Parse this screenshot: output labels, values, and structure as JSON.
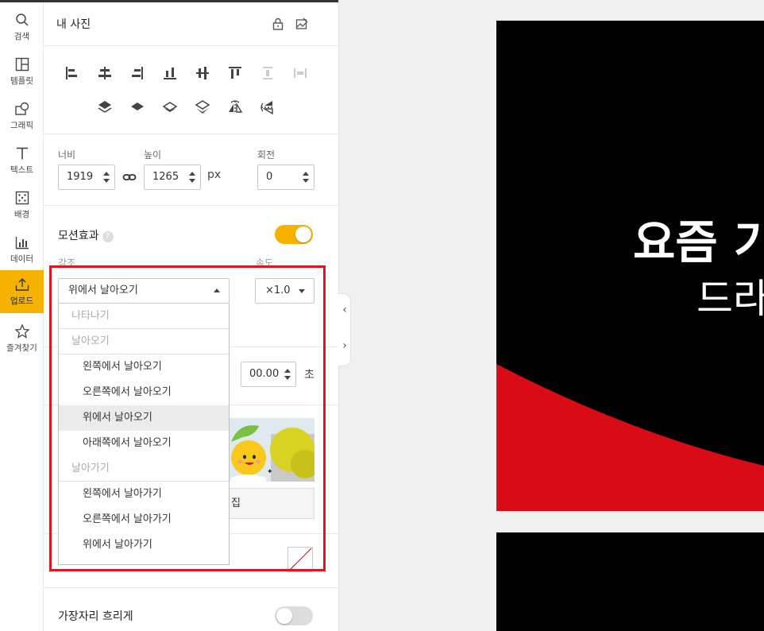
{
  "rail": {
    "items": [
      {
        "label": "검색",
        "icon": "search-icon"
      },
      {
        "label": "템플릿",
        "icon": "template-icon"
      },
      {
        "label": "그래픽",
        "icon": "graphic-icon"
      },
      {
        "label": "텍스트",
        "icon": "text-icon"
      },
      {
        "label": "배경",
        "icon": "background-icon"
      },
      {
        "label": "데이터",
        "icon": "chart-icon"
      },
      {
        "label": "업로드",
        "icon": "upload-icon",
        "active": true
      },
      {
        "label": "즐겨찾기",
        "icon": "star-icon"
      }
    ]
  },
  "panel": {
    "title": "내 사진",
    "size": {
      "width_label": "너비",
      "width_value": "1919",
      "height_label": "높이",
      "height_value": "1265",
      "unit": "px",
      "rotation_label": "회전",
      "rotation_value": "0"
    },
    "motion": {
      "title": "모션효과",
      "help": "?",
      "enabled": true,
      "emphasis_label": "강조",
      "speed_label": "속도",
      "selected_effect": "위에서 날아오기",
      "speed_value": "×1.0",
      "delay_value": "00.00",
      "delay_unit": "초"
    },
    "dropdown": {
      "groups": [
        {
          "label": "나타나기",
          "items": []
        },
        {
          "label": "날아오기",
          "items": [
            "왼쪽에서 날아오기",
            "오른쪽에서 날아오기",
            "위에서 날아오기",
            "아래쪽에서 날아오기"
          ]
        },
        {
          "label": "날아가기",
          "items": [
            "왼쪽에서 날아가기",
            "오른쪽에서 날아가기",
            "위에서 날아가기"
          ]
        }
      ]
    },
    "photo_edit_label": "집",
    "edge_blur_label": "가장자리 흐리게",
    "edge_blur_enabled": false
  },
  "canvas": {
    "title": "요즘 기",
    "subtitle": "드라"
  },
  "colors": {
    "accent": "#f6b200",
    "highlight": "#e0141e",
    "canvas_red": "#d90b14"
  }
}
